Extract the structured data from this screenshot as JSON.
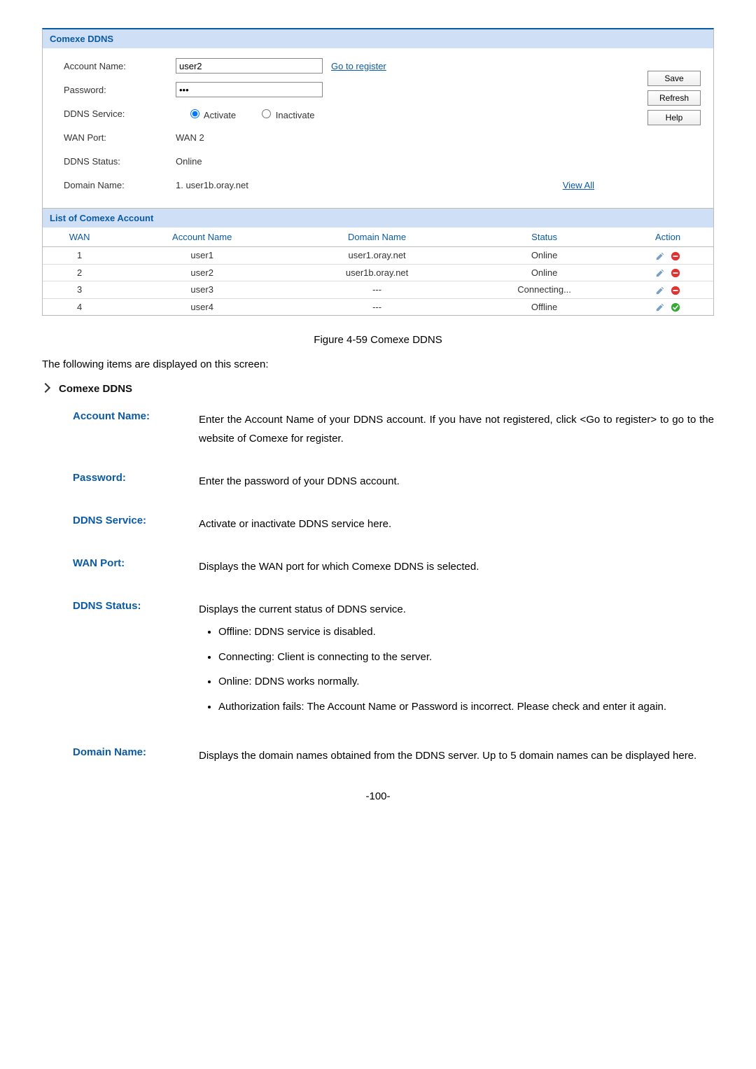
{
  "panel": {
    "title": "Comexe DDNS",
    "accountLabel": "Account Name:",
    "accountValue": "user2",
    "registerLink": "Go to register",
    "passwordLabel": "Password:",
    "passwordValue": "•••",
    "serviceLabel": "DDNS Service:",
    "activate": "Activate",
    "inactivate": "Inactivate",
    "wanPortLabel": "WAN Port:",
    "wanPortValue": "WAN 2",
    "ddnsStatusLabel": "DDNS Status:",
    "ddnsStatusValue": "Online",
    "domainLabel": "Domain Name:",
    "domainValue": "1. user1b.oray.net",
    "viewAll": "View All",
    "saveBtn": "Save",
    "refreshBtn": "Refresh",
    "helpBtn": "Help",
    "listTitle": "List of Comexe Account",
    "cols": {
      "wan": "WAN",
      "acct": "Account Name",
      "domain": "Domain Name",
      "status": "Status",
      "action": "Action"
    },
    "rows": [
      {
        "wan": "1",
        "acct": "user1",
        "domain": "user1.oray.net",
        "status": "Online",
        "enable": false
      },
      {
        "wan": "2",
        "acct": "user2",
        "domain": "user1b.oray.net",
        "status": "Online",
        "enable": false
      },
      {
        "wan": "3",
        "acct": "user3",
        "domain": "---",
        "status": "Connecting...",
        "enable": false
      },
      {
        "wan": "4",
        "acct": "user4",
        "domain": "---",
        "status": "Offline",
        "enable": true
      }
    ]
  },
  "caption": "Figure 4-59 Comexe DDNS",
  "introLine": "The following items are displayed on this screen:",
  "sectionTitle": "Comexe DDNS",
  "descs": {
    "account": {
      "label": "Account Name:",
      "text": "Enter the Account Name of your DDNS account. If you have not registered, click <Go to register> to go to the website of Comexe for register."
    },
    "password": {
      "label": "Password:",
      "text": "Enter the password of your DDNS account."
    },
    "service": {
      "label": "DDNS Service:",
      "text": "Activate or inactivate DDNS service here."
    },
    "wan": {
      "label": "WAN Port:",
      "text": "Displays the WAN port for which Comexe DDNS is selected."
    },
    "status": {
      "label": "DDNS Status:",
      "text": "Displays the current status of DDNS service.",
      "items": [
        "Offline: DDNS service is disabled.",
        "Connecting: Client is connecting to the server.",
        "Online: DDNS works normally.",
        "Authorization fails: The Account Name or Password is incorrect. Please check and enter it again."
      ]
    },
    "domain": {
      "label": "Domain Name:",
      "text": "Displays the domain names obtained from the DDNS server. Up to 5 domain names can be displayed here."
    }
  },
  "pageNum": "-100-"
}
